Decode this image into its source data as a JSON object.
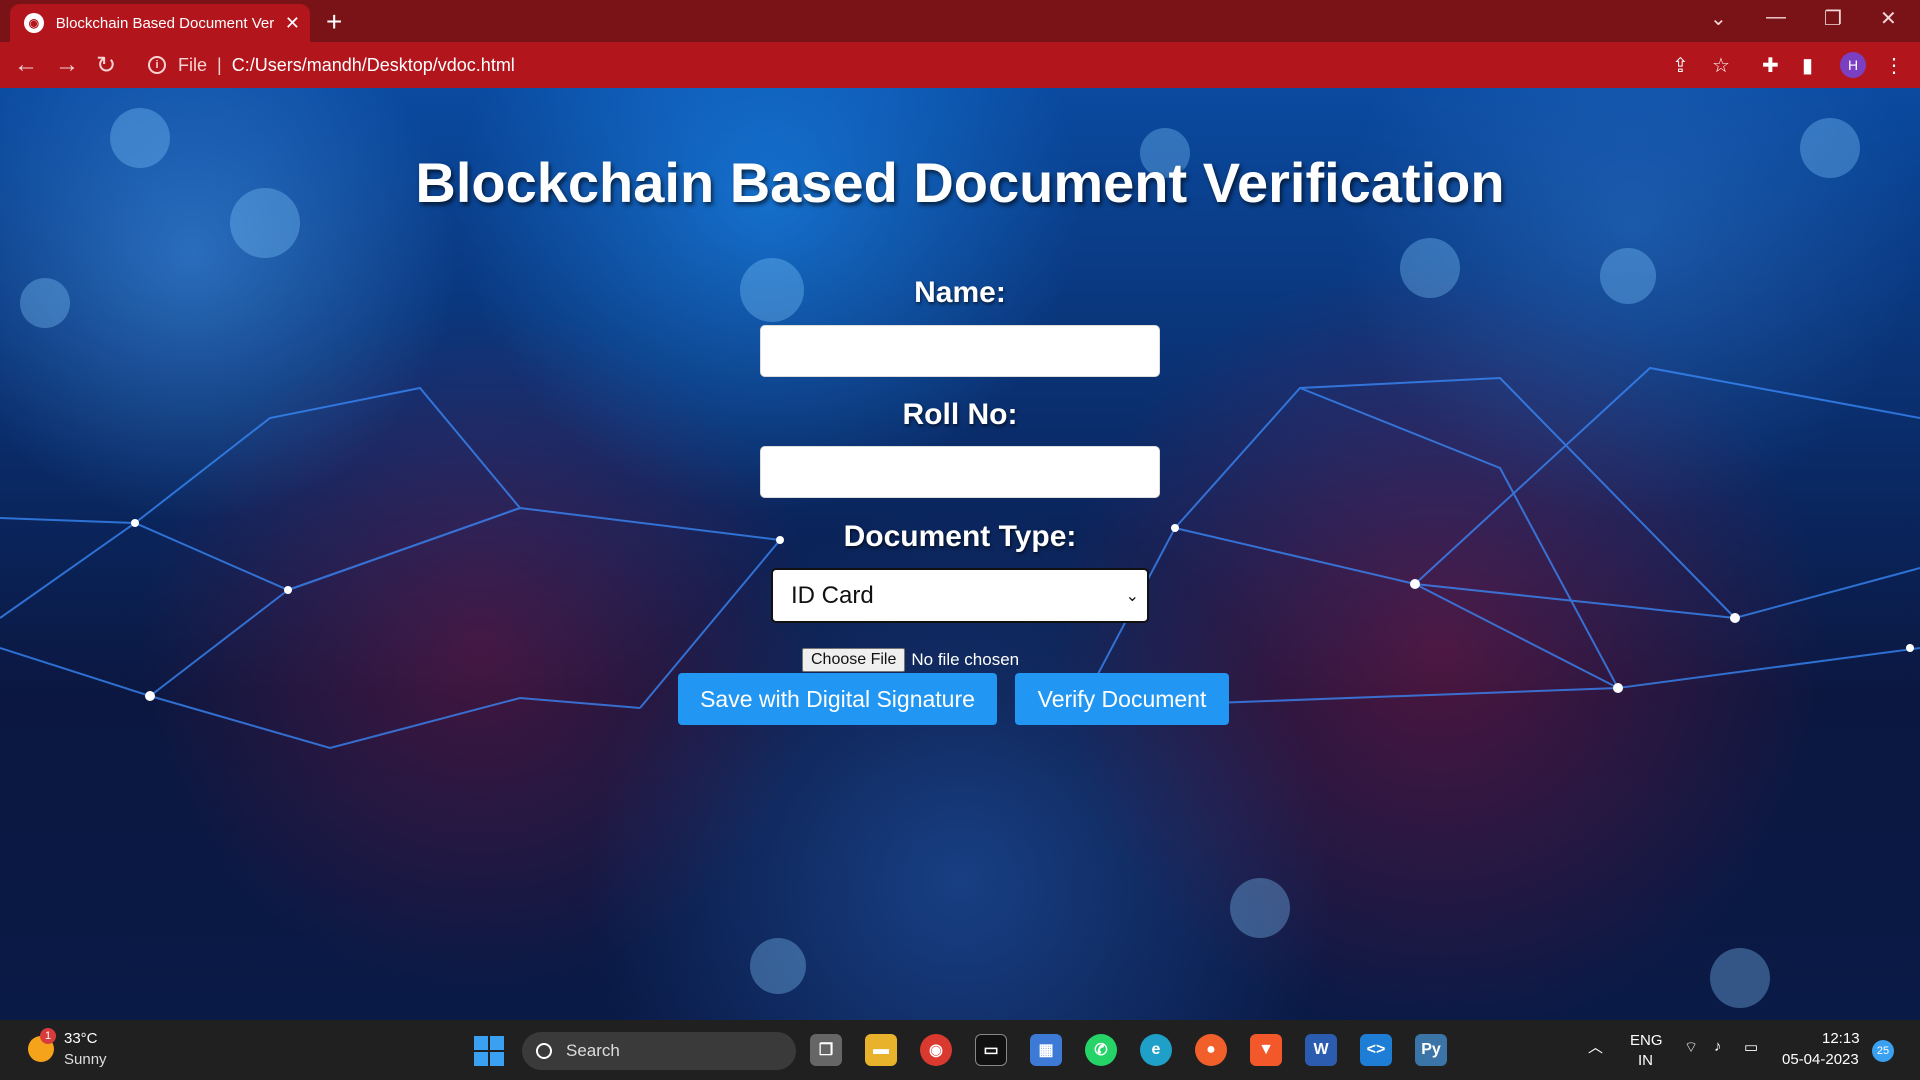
{
  "browser": {
    "tab_title": "Blockchain Based Document Veri",
    "url_scheme": "File",
    "url": "C:/Users/mandh/Desktop/vdoc.html",
    "profile_initial": "H"
  },
  "page": {
    "title": "Blockchain Based Document Verification",
    "name_label": "Name:",
    "name_value": "",
    "roll_label": "Roll No:",
    "roll_value": "",
    "doc_type_label": "Document Type:",
    "doc_type_selected": "ID Card",
    "choose_file_label": "Choose File",
    "file_status": "No file chosen",
    "save_button": "Save with Digital Signature",
    "verify_button": "Verify Document"
  },
  "taskbar": {
    "weather_temp": "33°C",
    "weather_condition": "Sunny",
    "weather_badge": "1",
    "search_label": "Search",
    "lang_top": "ENG",
    "lang_bottom": "IN",
    "time": "12:13",
    "date": "05-04-2023",
    "notification_count": "25",
    "apps": [
      "task-view",
      "file-explorer",
      "chrome",
      "terminal",
      "microsoft-store",
      "whatsapp",
      "edge",
      "firefox",
      "brave",
      "word",
      "vscode",
      "python"
    ]
  },
  "colors": {
    "tab_active": "#b3151c",
    "tabbar": "#7a1318",
    "button_blue": "#2196f3",
    "taskbar": "#202020"
  }
}
